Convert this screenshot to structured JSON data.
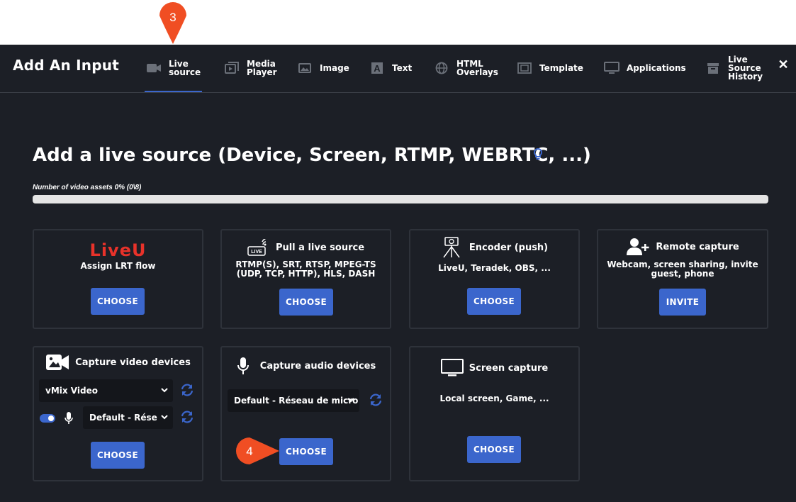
{
  "header": {
    "title": "Add An Input",
    "close_icon": "close-icon",
    "tabs": [
      {
        "label": "Live\nsource",
        "icon": "camera-icon",
        "active": true
      },
      {
        "label": "Media\nPlayer",
        "icon": "media-player-icon"
      },
      {
        "label": "Image",
        "icon": "image-icon"
      },
      {
        "label": "Text",
        "icon": "text-icon"
      },
      {
        "label": "HTML\nOverlays",
        "icon": "globe-icon"
      },
      {
        "label": "Template",
        "icon": "template-icon"
      },
      {
        "label": "Applications",
        "icon": "monitor-icon"
      },
      {
        "label": "Live\nSource\nHistory",
        "icon": "archive-icon"
      }
    ]
  },
  "main": {
    "title": "Add a live source (Device, Screen, RTMP, WEBRTC, ...)",
    "assets_label": "Number of video assets 0% (0\\8)",
    "assets_percent": 0
  },
  "cards": {
    "liveu": {
      "logo_text": "LiveU",
      "title": "Assign LRT flow",
      "button": "CHOOSE"
    },
    "pull": {
      "title": "Pull a live source",
      "desc": "RTMP(S), SRT, RTSP, MPEG-TS (UDP, TCP, HTTP), HLS, DASH",
      "button": "CHOOSE",
      "icon_text": "LIVE"
    },
    "encoder": {
      "title": "Encoder (push)",
      "desc": "LiveU, Teradek, OBS, ...",
      "button": "CHOOSE"
    },
    "remote": {
      "title": "Remote capture",
      "desc": "Webcam, screen sharing, invite guest, phone",
      "button": "INVITE"
    },
    "video": {
      "title": "Capture video devices",
      "select_video": "vMix Video",
      "select_audio": "Default - Réseau de micro",
      "button": "CHOOSE"
    },
    "audio": {
      "title": "Capture audio devices",
      "select": "Default - Réseau de micro",
      "button": "CHOOSE"
    },
    "screen": {
      "title": "Screen capture",
      "desc": "Local screen, Game, ...",
      "button": "CHOOSE"
    }
  },
  "callouts": {
    "tab_step": "3",
    "button_step": "4",
    "color": "#f04e23"
  },
  "colors": {
    "accent": "#3b66cc",
    "background": "#1c1f26",
    "liveu_red": "#e8322a"
  }
}
